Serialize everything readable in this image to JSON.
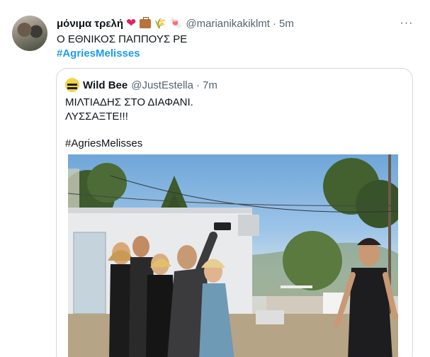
{
  "tweet": {
    "display_name": "μόνιμα τρελή",
    "emoji": {
      "heart": "❤",
      "wheat": "🌾",
      "candy": "🍬"
    },
    "handle": "@marianikakiklmt",
    "separator": "·",
    "time": "5m",
    "more_icon": "···",
    "text_line": "Ο ΕΘΝΙΚΟΣ ΠΑΠΠΟΥΣ ΡΕ",
    "hashtag": "#AgriesMelisses"
  },
  "quote": {
    "display_name": "Wild Bee",
    "handle": "@JustEstella",
    "separator": "·",
    "time": "7m",
    "line1": "ΜΙΛΤΙΑΔΗΣ ΣΤΟ ΔΙΑΦΑΝΙ.",
    "line2": "ΛΥΣΣΑΞΤΕ!!!",
    "hashtag": "#AgriesMelisses"
  },
  "colors": {
    "link": "#1d9bf0",
    "secondary_text": "#536471",
    "border": "#cfd9de"
  }
}
